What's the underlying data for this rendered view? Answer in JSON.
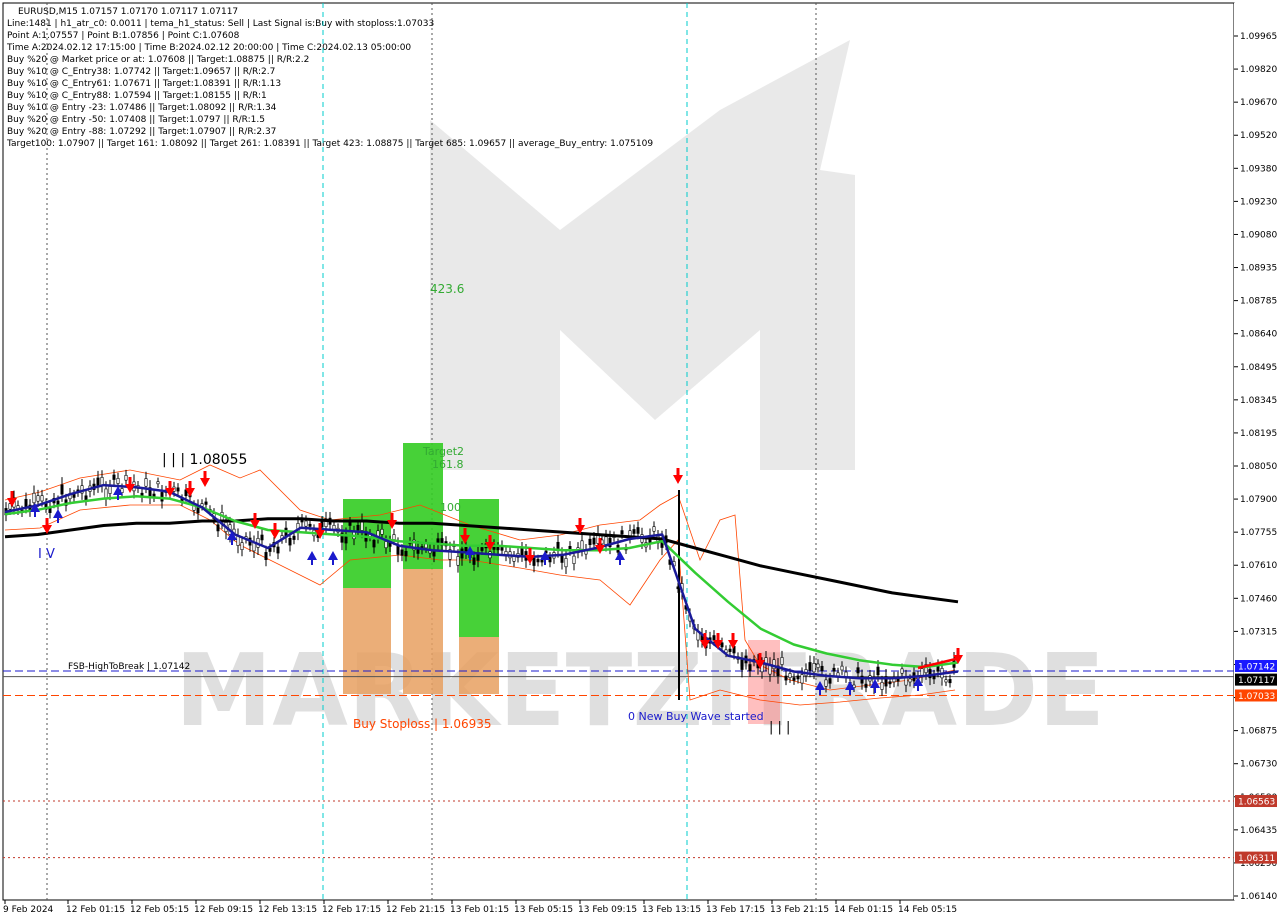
{
  "header": {
    "lines": [
      "EURUSD,M15  1.07157 1.07170 1.07117 1.07117",
      "Line:1481 | h1_atr_c0: 0.0011 | tema_h1_status: Sell | Last Signal is:Buy with stoploss:1.07033",
      "Point A:1.07557 | Point B:1.07856 | Point C:1.07608",
      "Time A:2024.02.12 17:15:00 | Time B:2024.02.12 20:00:00 | Time C:2024.02.13 05:00:00",
      "Buy %20 @ Market price or at: 1.07608 || Target:1.08875 || R/R:2.2",
      "Buy %10 @ C_Entry38: 1.07742 || Target:1.09657 || R/R:2.7",
      "Buy %10 @ C_Entry61: 1.07671 || Target:1.08391 || R/R:1.13",
      "Buy %10 @ C_Entry88: 1.07594 || Target:1.08155 || R/R:1",
      "Buy %10 @ Entry -23: 1.07486 || Target:1.08092 || R/R:1.34",
      "Buy %20 @ Entry -50: 1.07408 || Target:1.0797 || R/R:1.5",
      "Buy %20 @ Entry -88: 1.07292 || Target:1.07907 || R/R:2.37",
      "Target100: 1.07907 || Target 161: 1.08092 || Target 261: 1.08391 || Target 423: 1.08875 || Target 685: 1.09657 || average_Buy_entry: 1.075109"
    ]
  },
  "watermark": {
    "text": "MARKETZITRADE"
  },
  "annotations": {
    "high_label": "| | | 1.08055",
    "iv_label": "I V",
    "target_423": "423.6",
    "target2": "Target2",
    "target2_val": "161.8",
    "target100": "100",
    "fsb_label": "FSB-HighToBreak | 1.07142",
    "buy_stoploss": "Buy Stoploss | 1.06935",
    "new_wave": "0 New Buy Wave started",
    "bottom_marks": "| | |"
  },
  "price_tags": [
    {
      "value": "1.07142",
      "bg": "#1a1aff"
    },
    {
      "value": "1.07117",
      "bg": "#000000"
    },
    {
      "value": "1.07033",
      "bg": "#ff4500"
    },
    {
      "value": "1.06563",
      "bg": "#c0392b"
    },
    {
      "value": "1.06311",
      "bg": "#c0392b"
    }
  ],
  "colors": {
    "ma_black": "#000000",
    "ma_green": "#33cc33",
    "ma_navy": "#1a1a99",
    "channel": "#ff4500",
    "box_green": "#33cc22",
    "box_orange": "#e8a060",
    "box_pink": "#ff8080",
    "cyan": "#00cccc",
    "fsb": "#1a1acc"
  },
  "chart_data": {
    "type": "line",
    "title": "EURUSD,M15",
    "ylim": [
      1.0614,
      1.0997
    ],
    "y_ticks": [
      "1.09965",
      "1.09820",
      "1.09670",
      "1.09520",
      "1.09380",
      "1.09230",
      "1.09080",
      "1.08935",
      "1.08785",
      "1.08640",
      "1.08495",
      "1.08345",
      "1.08195",
      "1.08050",
      "1.07900",
      "1.07755",
      "1.07610",
      "1.07460",
      "1.07315",
      "1.07170",
      "1.07020",
      "1.06875",
      "1.06730",
      "1.06580",
      "1.06435",
      "1.06290",
      "1.06140"
    ],
    "x_ticks": [
      "9 Feb 2024",
      "12 Feb 01:15",
      "12 Feb 05:15",
      "12 Feb 09:15",
      "12 Feb 13:15",
      "12 Feb 17:15",
      "12 Feb 21:15",
      "13 Feb 01:15",
      "13 Feb 05:15",
      "13 Feb 09:15",
      "13 Feb 13:15",
      "13 Feb 17:15",
      "13 Feb 21:15",
      "14 Feb 01:15",
      "14 Feb 05:15"
    ],
    "series": [
      {
        "name": "",
        "color": "#000000",
        "values": [
          1.0774,
          1.0775,
          1.0777,
          1.0779,
          1.078,
          1.078,
          1.0781,
          1.0781,
          1.0782,
          1.0782,
          1.0781,
          1.0781,
          1.078,
          1.078,
          1.0779,
          1.0778,
          1.0777,
          1.0776,
          1.0775,
          1.0774,
          1.0773,
          1.0769,
          1.0765,
          1.0761,
          1.0758,
          1.0755,
          1.0752,
          1.0749,
          1.0747,
          1.0745
        ]
      },
      {
        "name": "",
        "color": "#33cc33",
        "values": [
          1.0784,
          1.0786,
          1.0789,
          1.0791,
          1.0792,
          1.0791,
          1.0787,
          1.0781,
          1.0777,
          1.0776,
          1.0775,
          1.0774,
          1.0772,
          1.0771,
          1.077,
          1.077,
          1.0769,
          1.0768,
          1.0768,
          1.0769,
          1.0772,
          1.0758,
          1.0745,
          1.0733,
          1.0726,
          1.0722,
          1.0719,
          1.0717,
          1.0716,
          1.0718
        ]
      },
      {
        "name": "",
        "color": "#1a1a99",
        "values": [
          1.0785,
          1.0788,
          1.0793,
          1.0797,
          1.0796,
          1.0794,
          1.0787,
          1.0775,
          1.0769,
          1.0778,
          1.0777,
          1.0776,
          1.077,
          1.0768,
          1.0767,
          1.0766,
          1.0765,
          1.0766,
          1.0769,
          1.0773,
          1.0775,
          1.0733,
          1.0721,
          1.0718,
          1.0714,
          1.0712,
          1.0711,
          1.0711,
          1.0712,
          1.0714
        ]
      }
    ],
    "boxes": [
      {
        "low": 1.0703,
        "high": 1.0795,
        "color": "green"
      },
      {
        "low": 1.0703,
        "high": 1.082,
        "color": "green"
      },
      {
        "low": 1.0703,
        "high": 1.0795,
        "color": "green"
      }
    ],
    "hlines": [
      {
        "value": 1.07142,
        "style": "dashed",
        "color": "#1a1acc"
      },
      {
        "value": 1.07117,
        "style": "solid",
        "color": "#555555"
      },
      {
        "value": 1.07033,
        "style": "dashed",
        "color": "#ff4500"
      },
      {
        "value": 1.06563,
        "style": "dotted",
        "color": "#c0392b"
      },
      {
        "value": 1.06311,
        "style": "dotted",
        "color": "#c0392b"
      }
    ],
    "grid": true
  }
}
